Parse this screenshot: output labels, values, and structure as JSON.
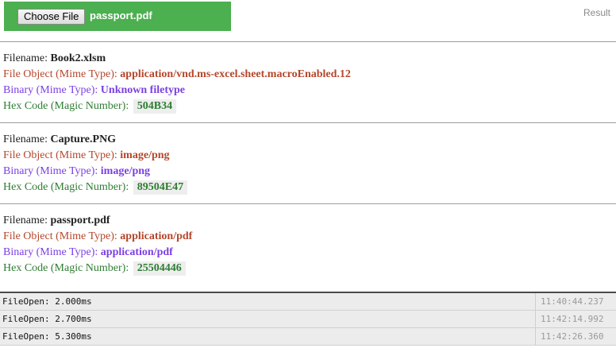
{
  "picker": {
    "button_label": "Choose File",
    "chosen_file": "passport.pdf",
    "color": "#4caf50"
  },
  "result_label": "Result",
  "labels": {
    "filename": "Filename:",
    "file_object": "File Object (Mime Type):",
    "binary": "Binary (Mime Type):",
    "hex": "Hex Code (Magic Number):"
  },
  "files": [
    {
      "filename": "Book2.xlsm",
      "file_object_mime": "application/vnd.ms-excel.sheet.macroEnabled.12",
      "binary_mime": "Unknown filetype",
      "hex_code": "504B34"
    },
    {
      "filename": "Capture.PNG",
      "file_object_mime": "image/png",
      "binary_mime": "image/png",
      "hex_code": "89504E47"
    },
    {
      "filename": "passport.pdf",
      "file_object_mime": "application/pdf",
      "binary_mime": "application/pdf",
      "hex_code": "25504446"
    }
  ],
  "console": [
    {
      "message": "FileOpen: 2.000ms",
      "time": "11:40:44.237"
    },
    {
      "message": "FileOpen: 2.700ms",
      "time": "11:42:14.992"
    },
    {
      "message": "FileOpen: 5.300ms",
      "time": "11:42:26.360"
    }
  ],
  "colors": {
    "file_object": "#b5462b",
    "binary": "#7b3fe4",
    "hex": "#2e7d32"
  }
}
